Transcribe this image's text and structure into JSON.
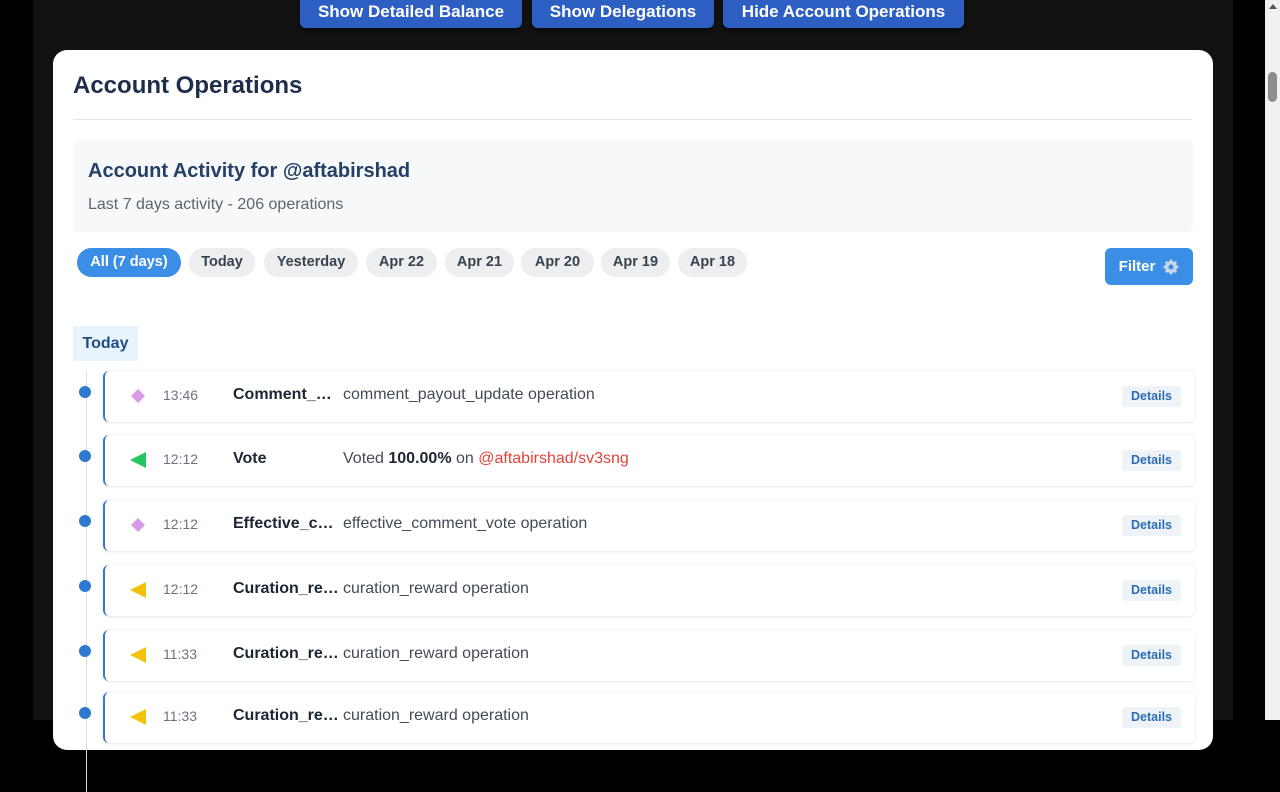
{
  "top_buttons": [
    "Show Detailed Balance",
    "Show Delegations",
    "Hide Account Operations"
  ],
  "panel": {
    "title": "Account Operations",
    "activity_title": "Account Activity for @aftabirshad",
    "activity_sub": "Last 7 days activity - 206 operations"
  },
  "date_tabs": [
    {
      "label": "All (7 days)",
      "active": true
    },
    {
      "label": "Today",
      "active": false
    },
    {
      "label": "Yesterday",
      "active": false
    },
    {
      "label": "Apr 22",
      "active": false
    },
    {
      "label": "Apr 21",
      "active": false
    },
    {
      "label": "Apr 20",
      "active": false
    },
    {
      "label": "Apr 19",
      "active": false
    },
    {
      "label": "Apr 18",
      "active": false
    }
  ],
  "filter_label": "Filter",
  "day_label": "Today",
  "details_label": "Details",
  "operations": [
    {
      "time": "13:46",
      "type": "Comment_payout_update",
      "icon": "diamond-icon",
      "color": "#d99ae8",
      "desc": "comment_payout_update operation"
    },
    {
      "time": "12:12",
      "type": "Vote",
      "icon": "vote-triangle-icon",
      "color": "#22c55e",
      "desc_prefix": "Voted ",
      "desc_bold": "100.00%",
      "desc_mid": " on ",
      "desc_link": "@aftabirshad/sv3sng"
    },
    {
      "time": "12:12",
      "type": "Effective_comment_vote",
      "icon": "diamond-icon",
      "color": "#d99ae8",
      "desc": "effective_comment_vote operation"
    },
    {
      "time": "12:12",
      "type": "Curation_reward",
      "icon": "reward-triangle-icon",
      "color": "#f4c20d",
      "desc": "curation_reward operation"
    },
    {
      "time": "11:33",
      "type": "Curation_reward",
      "icon": "reward-triangle-icon",
      "color": "#f4c20d",
      "desc": "curation_reward operation"
    },
    {
      "time": "11:33",
      "type": "Curation_reward",
      "icon": "reward-triangle-icon",
      "color": "#f4c20d",
      "desc": "curation_reward operation"
    }
  ]
}
